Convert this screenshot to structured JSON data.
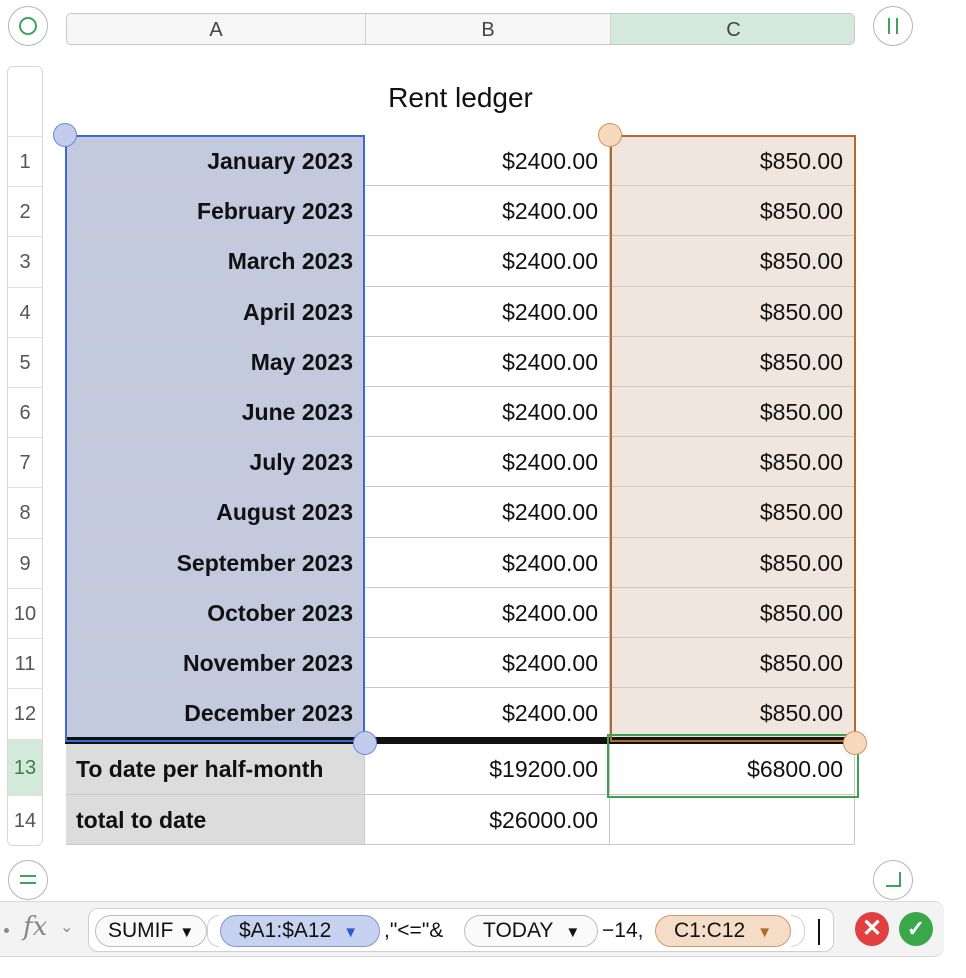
{
  "columns": [
    "A",
    "B",
    "C"
  ],
  "rows": [
    "1",
    "2",
    "3",
    "4",
    "5",
    "6",
    "7",
    "8",
    "9",
    "10",
    "11",
    "12",
    "13",
    "14"
  ],
  "table": {
    "title": "Rent ledger",
    "months": [
      "January 2023",
      "February 2023",
      "March 2023",
      "April 2023",
      "May 2023",
      "June 2023",
      "July 2023",
      "August 2023",
      "September 2023",
      "October 2023",
      "November 2023",
      "December 2023"
    ],
    "col_b": [
      "$2400.00",
      "$2400.00",
      "$2400.00",
      "$2400.00",
      "$2400.00",
      "$2400.00",
      "$2400.00",
      "$2400.00",
      "$2400.00",
      "$2400.00",
      "$2400.00",
      "$2400.00"
    ],
    "col_c": [
      "$850.00",
      "$850.00",
      "$850.00",
      "$850.00",
      "$850.00",
      "$850.00",
      "$850.00",
      "$850.00",
      "$850.00",
      "$850.00",
      "$850.00",
      "$850.00"
    ],
    "footer": [
      {
        "label": "To date per half-month",
        "b": "$19200.00",
        "c": "$6800.00"
      },
      {
        "label": "total to date",
        "b": "$26000.00",
        "c": ""
      }
    ]
  },
  "formula": {
    "fx": "fx",
    "fn_sumif": "SUMIF",
    "ref_a": "$A1:$A12",
    "op1": ",\"<=\"&",
    "fn_today": "TODAY",
    "op2": "−14,",
    "ref_c": "C1:C12"
  },
  "colors": {
    "selection_blue": "#3b69d6",
    "selection_orange": "#b06a2a",
    "accent_green": "#3aa052",
    "cancel_red": "#e04040"
  }
}
